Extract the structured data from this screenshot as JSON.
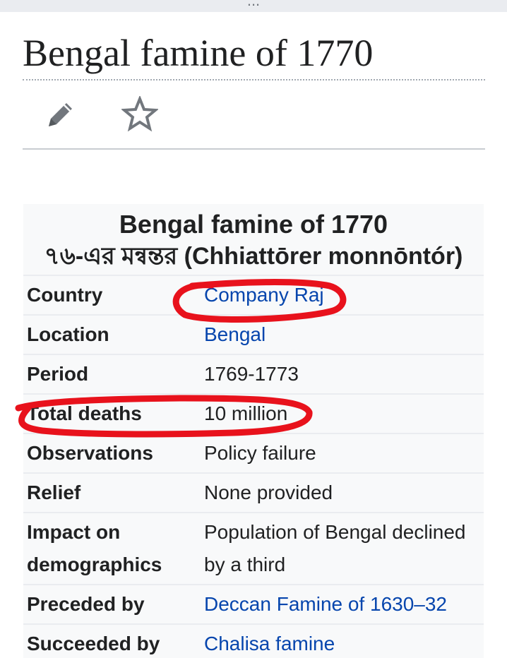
{
  "page": {
    "topbar_text": "...",
    "title": "Bengal famine of 1770"
  },
  "actions": {
    "edit_icon": "pencil-icon",
    "watch_icon": "star-icon"
  },
  "infobox": {
    "caption_line1": "Bengal famine of 1770",
    "caption_line2": "৭৬-এর মন্বন্তর (Chhiattōrer monnōntór)",
    "rows": [
      {
        "label": "Country",
        "value": "Company Raj",
        "is_link": true
      },
      {
        "label": "Location",
        "value": "Bengal",
        "is_link": true
      },
      {
        "label": "Period",
        "value": "1769-1773",
        "is_link": false
      },
      {
        "label": "Total deaths",
        "value": "10 million",
        "is_link": false
      },
      {
        "label": "Observations",
        "value": "Policy failure",
        "is_link": false
      },
      {
        "label": "Relief",
        "value": "None provided",
        "is_link": false
      },
      {
        "label": "Impact on demographics",
        "value": "Population of Bengal declined by a third",
        "is_link": false
      },
      {
        "label": "Preceded by",
        "value": "Deccan Famine of 1630–32",
        "is_link": true
      },
      {
        "label": "Succeeded by",
        "value": "Chalisa famine",
        "is_link": true
      }
    ]
  },
  "colors": {
    "link": "#0645ad",
    "annotation": "#e8121c"
  }
}
